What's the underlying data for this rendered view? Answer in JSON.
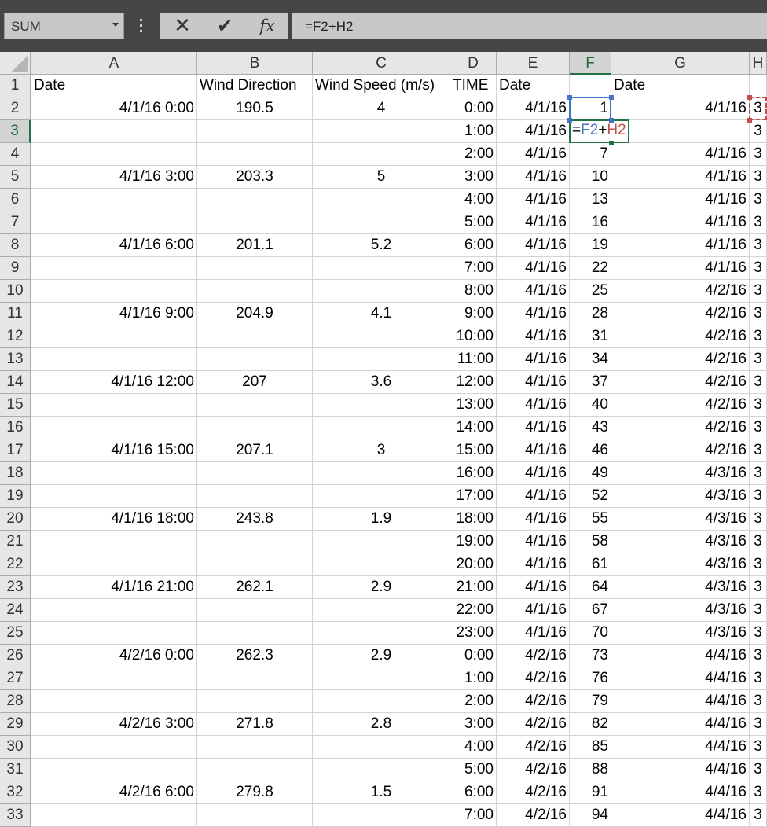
{
  "formula_bar": {
    "name_box": "SUM",
    "cancel_glyph": "✕",
    "enter_glyph": "✔",
    "fx_label": "fx",
    "formula": "=F2+H2"
  },
  "columns": [
    "A",
    "B",
    "C",
    "D",
    "E",
    "F",
    "G",
    "H"
  ],
  "selected_column": "F",
  "selected_row": 3,
  "editing": {
    "prefix": "=",
    "ref1": "F2",
    "op": "+",
    "ref2": "H2"
  },
  "rows": [
    {
      "n": 1,
      "A": "Date",
      "B": "Wind Direction",
      "C": "Wind Speed (m/s)",
      "D": "TIME",
      "E": "Date",
      "F": "",
      "G": "Date",
      "H": ""
    },
    {
      "n": 2,
      "A": "4/1/16 0:00",
      "B": "190.5",
      "C": "4",
      "D": "0:00",
      "E": "4/1/16",
      "F": "1",
      "G": "4/1/16",
      "H": "3"
    },
    {
      "n": 3,
      "A": "",
      "B": "",
      "C": "",
      "D": "1:00",
      "E": "4/1/16",
      "F": "",
      "G": "",
      "H": "3"
    },
    {
      "n": 4,
      "A": "",
      "B": "",
      "C": "",
      "D": "2:00",
      "E": "4/1/16",
      "F": "7",
      "G": "4/1/16",
      "H": "3"
    },
    {
      "n": 5,
      "A": "4/1/16 3:00",
      "B": "203.3",
      "C": "5",
      "D": "3:00",
      "E": "4/1/16",
      "F": "10",
      "G": "4/1/16",
      "H": "3"
    },
    {
      "n": 6,
      "A": "",
      "B": "",
      "C": "",
      "D": "4:00",
      "E": "4/1/16",
      "F": "13",
      "G": "4/1/16",
      "H": "3"
    },
    {
      "n": 7,
      "A": "",
      "B": "",
      "C": "",
      "D": "5:00",
      "E": "4/1/16",
      "F": "16",
      "G": "4/1/16",
      "H": "3"
    },
    {
      "n": 8,
      "A": "4/1/16 6:00",
      "B": "201.1",
      "C": "5.2",
      "D": "6:00",
      "E": "4/1/16",
      "F": "19",
      "G": "4/1/16",
      "H": "3"
    },
    {
      "n": 9,
      "A": "",
      "B": "",
      "C": "",
      "D": "7:00",
      "E": "4/1/16",
      "F": "22",
      "G": "4/1/16",
      "H": "3"
    },
    {
      "n": 10,
      "A": "",
      "B": "",
      "C": "",
      "D": "8:00",
      "E": "4/1/16",
      "F": "25",
      "G": "4/2/16",
      "H": "3"
    },
    {
      "n": 11,
      "A": "4/1/16 9:00",
      "B": "204.9",
      "C": "4.1",
      "D": "9:00",
      "E": "4/1/16",
      "F": "28",
      "G": "4/2/16",
      "H": "3"
    },
    {
      "n": 12,
      "A": "",
      "B": "",
      "C": "",
      "D": "10:00",
      "E": "4/1/16",
      "F": "31",
      "G": "4/2/16",
      "H": "3"
    },
    {
      "n": 13,
      "A": "",
      "B": "",
      "C": "",
      "D": "11:00",
      "E": "4/1/16",
      "F": "34",
      "G": "4/2/16",
      "H": "3"
    },
    {
      "n": 14,
      "A": "4/1/16 12:00",
      "B": "207",
      "C": "3.6",
      "D": "12:00",
      "E": "4/1/16",
      "F": "37",
      "G": "4/2/16",
      "H": "3"
    },
    {
      "n": 15,
      "A": "",
      "B": "",
      "C": "",
      "D": "13:00",
      "E": "4/1/16",
      "F": "40",
      "G": "4/2/16",
      "H": "3"
    },
    {
      "n": 16,
      "A": "",
      "B": "",
      "C": "",
      "D": "14:00",
      "E": "4/1/16",
      "F": "43",
      "G": "4/2/16",
      "H": "3"
    },
    {
      "n": 17,
      "A": "4/1/16 15:00",
      "B": "207.1",
      "C": "3",
      "D": "15:00",
      "E": "4/1/16",
      "F": "46",
      "G": "4/2/16",
      "H": "3"
    },
    {
      "n": 18,
      "A": "",
      "B": "",
      "C": "",
      "D": "16:00",
      "E": "4/1/16",
      "F": "49",
      "G": "4/3/16",
      "H": "3"
    },
    {
      "n": 19,
      "A": "",
      "B": "",
      "C": "",
      "D": "17:00",
      "E": "4/1/16",
      "F": "52",
      "G": "4/3/16",
      "H": "3"
    },
    {
      "n": 20,
      "A": "4/1/16 18:00",
      "B": "243.8",
      "C": "1.9",
      "D": "18:00",
      "E": "4/1/16",
      "F": "55",
      "G": "4/3/16",
      "H": "3"
    },
    {
      "n": 21,
      "A": "",
      "B": "",
      "C": "",
      "D": "19:00",
      "E": "4/1/16",
      "F": "58",
      "G": "4/3/16",
      "H": "3"
    },
    {
      "n": 22,
      "A": "",
      "B": "",
      "C": "",
      "D": "20:00",
      "E": "4/1/16",
      "F": "61",
      "G": "4/3/16",
      "H": "3"
    },
    {
      "n": 23,
      "A": "4/1/16 21:00",
      "B": "262.1",
      "C": "2.9",
      "D": "21:00",
      "E": "4/1/16",
      "F": "64",
      "G": "4/3/16",
      "H": "3"
    },
    {
      "n": 24,
      "A": "",
      "B": "",
      "C": "",
      "D": "22:00",
      "E": "4/1/16",
      "F": "67",
      "G": "4/3/16",
      "H": "3"
    },
    {
      "n": 25,
      "A": "",
      "B": "",
      "C": "",
      "D": "23:00",
      "E": "4/1/16",
      "F": "70",
      "G": "4/3/16",
      "H": "3"
    },
    {
      "n": 26,
      "A": "4/2/16 0:00",
      "B": "262.3",
      "C": "2.9",
      "D": "0:00",
      "E": "4/2/16",
      "F": "73",
      "G": "4/4/16",
      "H": "3"
    },
    {
      "n": 27,
      "A": "",
      "B": "",
      "C": "",
      "D": "1:00",
      "E": "4/2/16",
      "F": "76",
      "G": "4/4/16",
      "H": "3"
    },
    {
      "n": 28,
      "A": "",
      "B": "",
      "C": "",
      "D": "2:00",
      "E": "4/2/16",
      "F": "79",
      "G": "4/4/16",
      "H": "3"
    },
    {
      "n": 29,
      "A": "4/2/16 3:00",
      "B": "271.8",
      "C": "2.8",
      "D": "3:00",
      "E": "4/2/16",
      "F": "82",
      "G": "4/4/16",
      "H": "3"
    },
    {
      "n": 30,
      "A": "",
      "B": "",
      "C": "",
      "D": "4:00",
      "E": "4/2/16",
      "F": "85",
      "G": "4/4/16",
      "H": "3"
    },
    {
      "n": 31,
      "A": "",
      "B": "",
      "C": "",
      "D": "5:00",
      "E": "4/2/16",
      "F": "88",
      "G": "4/4/16",
      "H": "3"
    },
    {
      "n": 32,
      "A": "4/2/16 6:00",
      "B": "279.8",
      "C": "1.5",
      "D": "6:00",
      "E": "4/2/16",
      "F": "91",
      "G": "4/4/16",
      "H": "3"
    },
    {
      "n": 33,
      "A": "",
      "B": "",
      "C": "",
      "D": "7:00",
      "E": "4/2/16",
      "F": "94",
      "G": "4/4/16",
      "H": "3"
    }
  ]
}
